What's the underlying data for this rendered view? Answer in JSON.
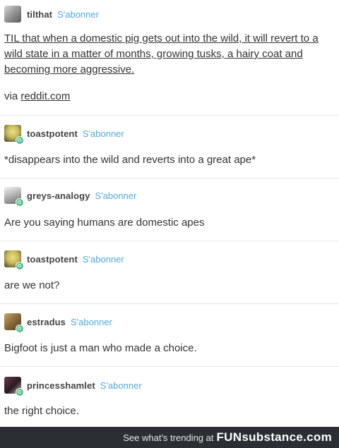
{
  "posts": [
    {
      "username": "tilthat",
      "follow": "S'abonner",
      "text": "TIL that when a domestic pig gets out into the wild, it will revert to a wild state in a matter of months, growing tusks, a hairy coat and becoming more aggressive.",
      "via_label": "via",
      "via_link": "reddit.com"
    },
    {
      "username": "toastpotent",
      "follow": "S'abonner",
      "text": "*disappears into the wild and reverts into a great ape*"
    },
    {
      "username": "greys-analogy",
      "follow": "S'abonner",
      "text": "Are you saying humans are domestic apes"
    },
    {
      "username": "toastpotent",
      "follow": "S'abonner",
      "text": "are we not?"
    },
    {
      "username": "estradus",
      "follow": "S'abonner",
      "text": "Bigfoot is just a man who made a choice."
    },
    {
      "username": "princesshamlet",
      "follow": "S'abonner",
      "text": "the right choice."
    }
  ],
  "footer": {
    "trend_text": "See what's trending at",
    "brand": "FUNsubstance.com"
  },
  "colors": {
    "follow": "#56a8d6",
    "badge": "#56bc8a",
    "footer_bg": "#2b2f33"
  }
}
